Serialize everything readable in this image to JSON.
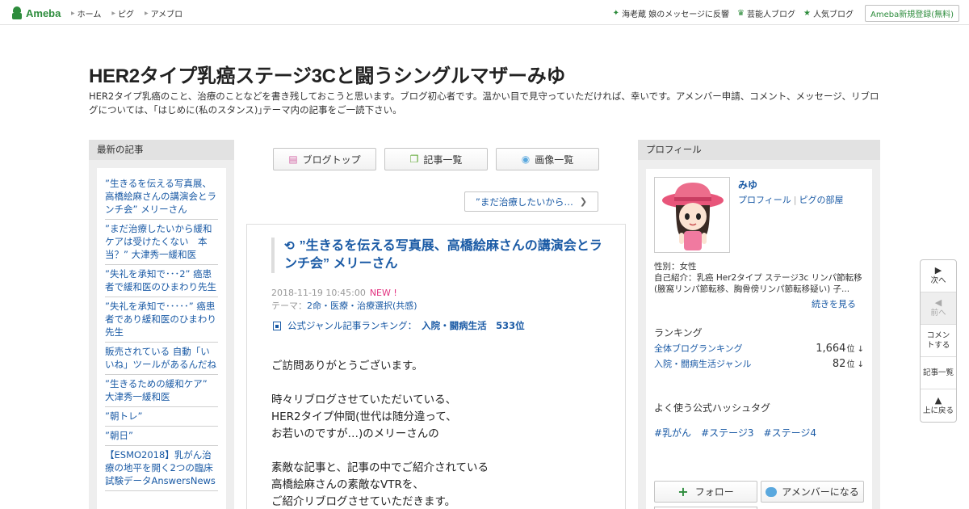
{
  "topbar": {
    "logo_text": "Ameba",
    "nav": [
      "ホーム",
      "ピグ",
      "アメブロ"
    ],
    "news": "海老蔵 娘のメッセージに反響",
    "celeb": "芸能人ブログ",
    "popular": "人気ブログ",
    "register": "Ameba新規登録(無料)"
  },
  "header": {
    "title": "HER2タイプ乳癌ステージ3Cと闘うシングルマザーみゆ",
    "description": "HER2タイプ乳癌のこと、治療のことなどを書き残しておこうと思います。ブログ初心者です。温かい目で見守っていただければ、幸いです。アメンバー申請、コメント、メッセージ、リブログについては、｢はじめに(私のスタンス)｣テーマ内の記事をご一読下さい。"
  },
  "left": {
    "heading": "最新の記事",
    "items": [
      "”生きるを伝える写真展、高橋絵麻さんの講演会とランチ会” メリーさん",
      "”まだ治療したいから緩和ケアは受けたくない　本当？” 大津秀一緩和医",
      "”失礼を承知で･･･2” 癌患者で緩和医のひまわり先生",
      "”失礼を承知で･････” 癌患者であり緩和医のひまわり先生",
      "販売されている 自動「いいね」ツールがあるんだね",
      "”生きるための緩和ケア” 大津秀一緩和医",
      "”朝トレ”",
      "”朝日”",
      "【ESMO2018】乳がん治療の地平を開く2つの臨床試験データAnswersNews"
    ]
  },
  "tabs": {
    "top": "ブログトップ",
    "list": "記事一覧",
    "images": "画像一覧"
  },
  "prev_link": "”まだ治療したいから…",
  "article": {
    "title": "”生きるを伝える写真展、高橋絵麻さんの講演会とランチ会” メリーさん",
    "date": "2018-11-19 10:45:00",
    "new_badge": "NEW !",
    "theme_label": "テーマ：",
    "theme": "2命・医療・治療選択(共感)",
    "ranking_label": "公式ジャンル記事ランキング：",
    "ranking_genre": "入院・闘病生活　533位",
    "body": [
      "ご訪問ありがとうございます。",
      "",
      "時々リブログさせていただいている、",
      "HER2タイプ仲間(世代は随分違って、",
      "お若いのですが…)のメリーさんの",
      "",
      "素敵な記事と、記事の中でご紹介されている",
      "高橋絵麻さんの素敵なVTRを、",
      "ご紹介リブログさせていただきます。"
    ]
  },
  "right": {
    "heading": "プロフィール",
    "name": "みゆ",
    "link_profile": "プロフィール",
    "link_pigg": "ピグの部屋",
    "gender": "性別：女性",
    "intro": "自己紹介：乳癌 Her2タイプ ステージ3c リンパ節転移 (腋窩リンパ節転移、胸骨傍リンパ節転移疑い) 子...",
    "more": "続きを見る",
    "ranking_head": "ランキング",
    "rank_all_label": "全体ブログランキング",
    "rank_all_value": "1,664",
    "rank_genre_label": "入院・闘病生活ジャンル",
    "rank_genre_value": "82",
    "rank_unit": "位 ↓",
    "hashtag_head": "よく使う公式ハッシュタグ",
    "hashtags": [
      "#乳がん",
      "#ステージ3",
      "#ステージ4"
    ],
    "follow": "フォロー",
    "member": "アメンバーになる"
  },
  "floatnav": {
    "next": "次へ",
    "prev": "前へ",
    "comment": "コメントする",
    "list": "記事一覧",
    "top": "上に戻る"
  }
}
